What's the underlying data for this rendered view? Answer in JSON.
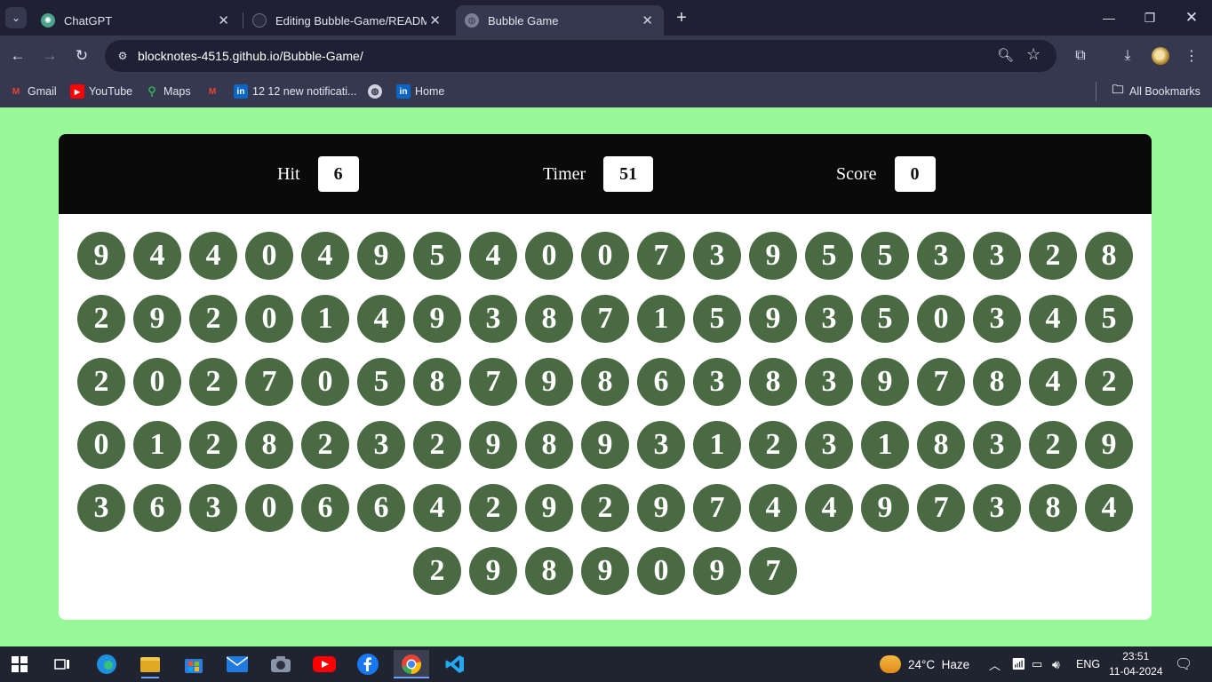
{
  "browser": {
    "tabs": [
      {
        "title": "ChatGPT",
        "icon": "chatgpt-icon",
        "active": false
      },
      {
        "title": "Editing Bubble-Game/README.md",
        "icon": "github-icon",
        "active": false
      },
      {
        "title": "Bubble Game",
        "icon": "globe-icon",
        "active": true
      }
    ],
    "url": "blocknotes-4515.github.io/Bubble-Game/",
    "bookmarks": [
      {
        "label": "Gmail",
        "icon": "gmail-icon"
      },
      {
        "label": "YouTube",
        "icon": "youtube-icon"
      },
      {
        "label": "Maps",
        "icon": "maps-icon"
      },
      {
        "label": "",
        "icon": "gmail-icon"
      },
      {
        "label": "12 12 new notificati...",
        "icon": "linkedin-icon"
      },
      {
        "label": "",
        "icon": "globe-icon"
      },
      {
        "label": "Home",
        "icon": "linkedin-icon"
      }
    ],
    "all_bookmarks": "All Bookmarks"
  },
  "game": {
    "hit_label": "Hit",
    "hit_value": "6",
    "timer_label": "Timer",
    "timer_value": "51",
    "score_label": "Score",
    "score_value": "0",
    "bubbles": [
      9,
      4,
      4,
      0,
      4,
      9,
      5,
      4,
      0,
      0,
      7,
      3,
      9,
      5,
      5,
      3,
      3,
      2,
      8,
      2,
      9,
      2,
      0,
      1,
      4,
      9,
      3,
      8,
      7,
      1,
      5,
      9,
      3,
      5,
      0,
      3,
      4,
      5,
      2,
      0,
      2,
      7,
      0,
      5,
      8,
      7,
      9,
      8,
      6,
      3,
      8,
      3,
      9,
      7,
      8,
      4,
      2,
      0,
      1,
      2,
      8,
      2,
      3,
      2,
      9,
      8,
      9,
      3,
      1,
      2,
      3,
      1,
      8,
      3,
      2,
      9,
      3,
      6,
      3,
      0,
      6,
      6,
      4,
      2,
      9,
      2,
      9,
      7,
      4,
      4,
      9,
      7,
      3,
      8,
      4,
      2,
      9,
      8,
      9,
      0,
      9,
      7
    ],
    "bubble_color": "#4a6a44",
    "page_background": "#98f898"
  },
  "taskbar": {
    "weather": "24°C  Haze",
    "language": "ENG",
    "time": "23:51",
    "date": "11-04-2024"
  }
}
